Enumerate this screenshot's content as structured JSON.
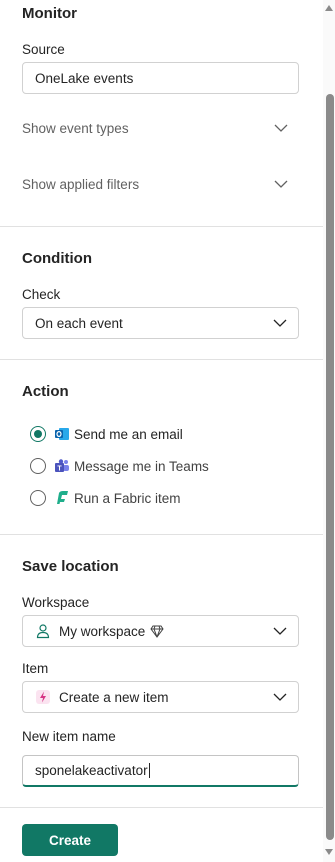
{
  "monitor": {
    "title": "Monitor",
    "source_label": "Source",
    "source_value": "OneLake events",
    "show_event_types": "Show event types",
    "show_applied_filters": "Show applied filters"
  },
  "condition": {
    "title": "Condition",
    "check_label": "Check",
    "check_value": "On each event"
  },
  "action": {
    "title": "Action",
    "options": [
      {
        "label": "Send me an email",
        "icon": "outlook-icon",
        "selected": true
      },
      {
        "label": "Message me in Teams",
        "icon": "teams-icon",
        "selected": false
      },
      {
        "label": "Run a Fabric item",
        "icon": "fabric-icon",
        "selected": false
      }
    ]
  },
  "save_location": {
    "title": "Save location",
    "workspace_label": "Workspace",
    "workspace_value": "My workspace",
    "item_label": "Item",
    "item_value": "Create a new item",
    "new_item_name_label": "New item name",
    "new_item_name_value": "sponelakeactivator"
  },
  "footer": {
    "create_label": "Create"
  },
  "colors": {
    "accent": "#117865",
    "text": "#242424",
    "muted": "#616161",
    "border": "#d1d1d1"
  }
}
